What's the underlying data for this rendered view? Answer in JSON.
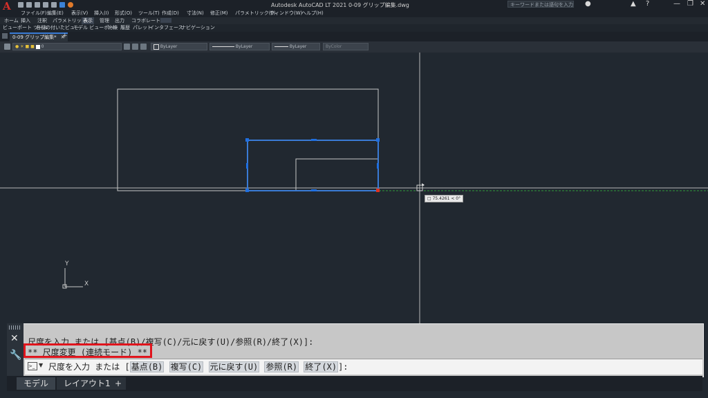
{
  "titlebar": {
    "app_logo": "A",
    "title": "Autodesk AutoCAD LT 2021   0-09 グリップ編集.dwg",
    "search_placeholder": "キーワードまたは語句を入力",
    "minimize": "—",
    "restore": "❐",
    "close": "✕"
  },
  "menubar": {
    "items": [
      "ファイル(F)",
      "編集(E)",
      "表示(V)",
      "挿入(I)",
      "形式(O)",
      "ツール(T)",
      "作成(D)",
      "寸法(N)",
      "修正(M)",
      "パラメトリック(P)",
      "ウィンドウ(W)",
      "ヘルプ(H)"
    ]
  },
  "ribbon": {
    "tabs": [
      "ホーム",
      "挿入",
      "注釈",
      "パラメトリック",
      "表示",
      "管理",
      "出力",
      "コラボレート"
    ],
    "active_tab": "表示",
    "panels": [
      "ビューポート ツール",
      "名前の付いたビュー",
      "モデル ビューポート",
      "比較",
      "履歴",
      "パレット",
      "インタフェース",
      "ナビゲーション"
    ]
  },
  "document": {
    "tab_label": "0-09 グリップ編集*",
    "tab_close": "✕",
    "new_tab": "+"
  },
  "layers": {
    "current_layer": "0",
    "color": "ByLayer",
    "linetype": "ByLayer",
    "lineweight": "ByLayer",
    "plotstyle": "ByColor"
  },
  "canvas": {
    "tooltip": "75.4261 < 0°",
    "ucs_x": "X",
    "ucs_y": "Y",
    "colors": {
      "background": "#212830",
      "lines": "#c8c8c8",
      "selection": "#3a7bd5",
      "grip": "#1f6fe0",
      "hot_grip": "#e03020",
      "tracking": "#2e9a3a"
    }
  },
  "command": {
    "line1": "尺度を入力 または [基点(B)/複写(C)/元に戻す(U)/参照(R)/終了(X)]:",
    "line2": "** 尺度変更 (連続モード) **",
    "prompt_prefix": "尺度を入力 または [",
    "options": [
      "基点(B)",
      "複写(C)",
      "元に戻す(U)",
      "参照(R)",
      "終了(X)"
    ],
    "prompt_suffix": "]:"
  },
  "layout_tabs": {
    "model": "モデル",
    "layout1": "レイアウト1",
    "add": "+"
  }
}
